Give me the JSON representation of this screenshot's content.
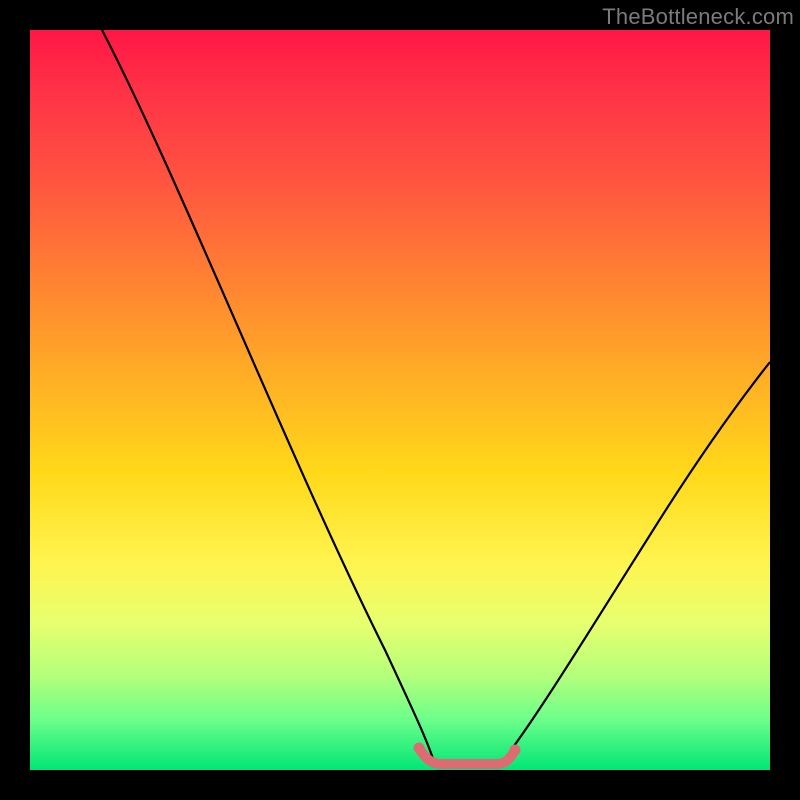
{
  "watermark": {
    "text": "TheBottleneck.com"
  },
  "chart_data": {
    "type": "line",
    "title": "",
    "xlabel": "",
    "ylabel": "",
    "xlim": [
      0,
      100
    ],
    "ylim": [
      0,
      100
    ],
    "series": [
      {
        "name": "curve-left",
        "x": [
          10,
          20,
          30,
          40,
          48,
          52,
          54
        ],
        "values": [
          100,
          79,
          58,
          37,
          14,
          4,
          0
        ]
      },
      {
        "name": "plateau",
        "x": [
          54,
          64
        ],
        "values": [
          0,
          0
        ]
      },
      {
        "name": "curve-right",
        "x": [
          64,
          70,
          80,
          90,
          100
        ],
        "values": [
          0,
          8,
          24,
          40,
          55
        ]
      },
      {
        "name": "marker-band",
        "x": [
          52.5,
          65
        ],
        "values": [
          1.5,
          1.5
        ]
      }
    ],
    "colors": {
      "curve": "#000000",
      "marker": "#e57373"
    }
  }
}
